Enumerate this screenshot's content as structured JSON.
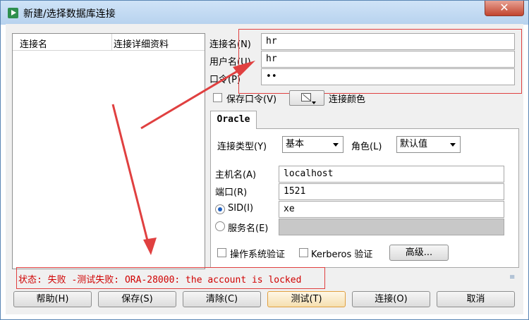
{
  "window": {
    "title": "新建/选择数据库连接",
    "close_glyph": "✕"
  },
  "list": {
    "col_name": "连接名",
    "col_details": "连接详细资料"
  },
  "form": {
    "conn_name_label": "连接名(N)",
    "conn_name_value": "hr",
    "user_label": "用户名(U)",
    "user_value": "hr",
    "password_label": "口令(P)",
    "password_value": "••",
    "save_password_label": "保存口令(V)",
    "save_password_checked": false,
    "conn_color_label": "连接颜色"
  },
  "tab": {
    "label": "Oracle"
  },
  "oracle": {
    "conn_type_label": "连接类型(Y)",
    "conn_type_value": "基本",
    "role_label": "角色(L)",
    "role_value": "默认值",
    "host_label": "主机名(A)",
    "host_value": "localhost",
    "port_label": "端口(R)",
    "port_value": "1521",
    "sid_label": "SID(I)",
    "sid_value": "xe",
    "sid_selected": true,
    "service_label": "服务名(E)",
    "service_value": "",
    "os_auth_label": "操作系统验证",
    "kerberos_label": "Kerberos 验证",
    "advanced_label": "高级..."
  },
  "status": {
    "text": "状态: 失败 -测试失败: ORA-28000: the account is locked"
  },
  "buttons": {
    "help": "帮助(H)",
    "save": "保存(S)",
    "clear": "清除(C)",
    "test": "测试(T)",
    "connect": "连接(O)",
    "cancel": "取消"
  },
  "colors": {
    "annotation_red": "#e04040",
    "status_red": "#d00000",
    "title_bg": "#cfe3f7"
  }
}
